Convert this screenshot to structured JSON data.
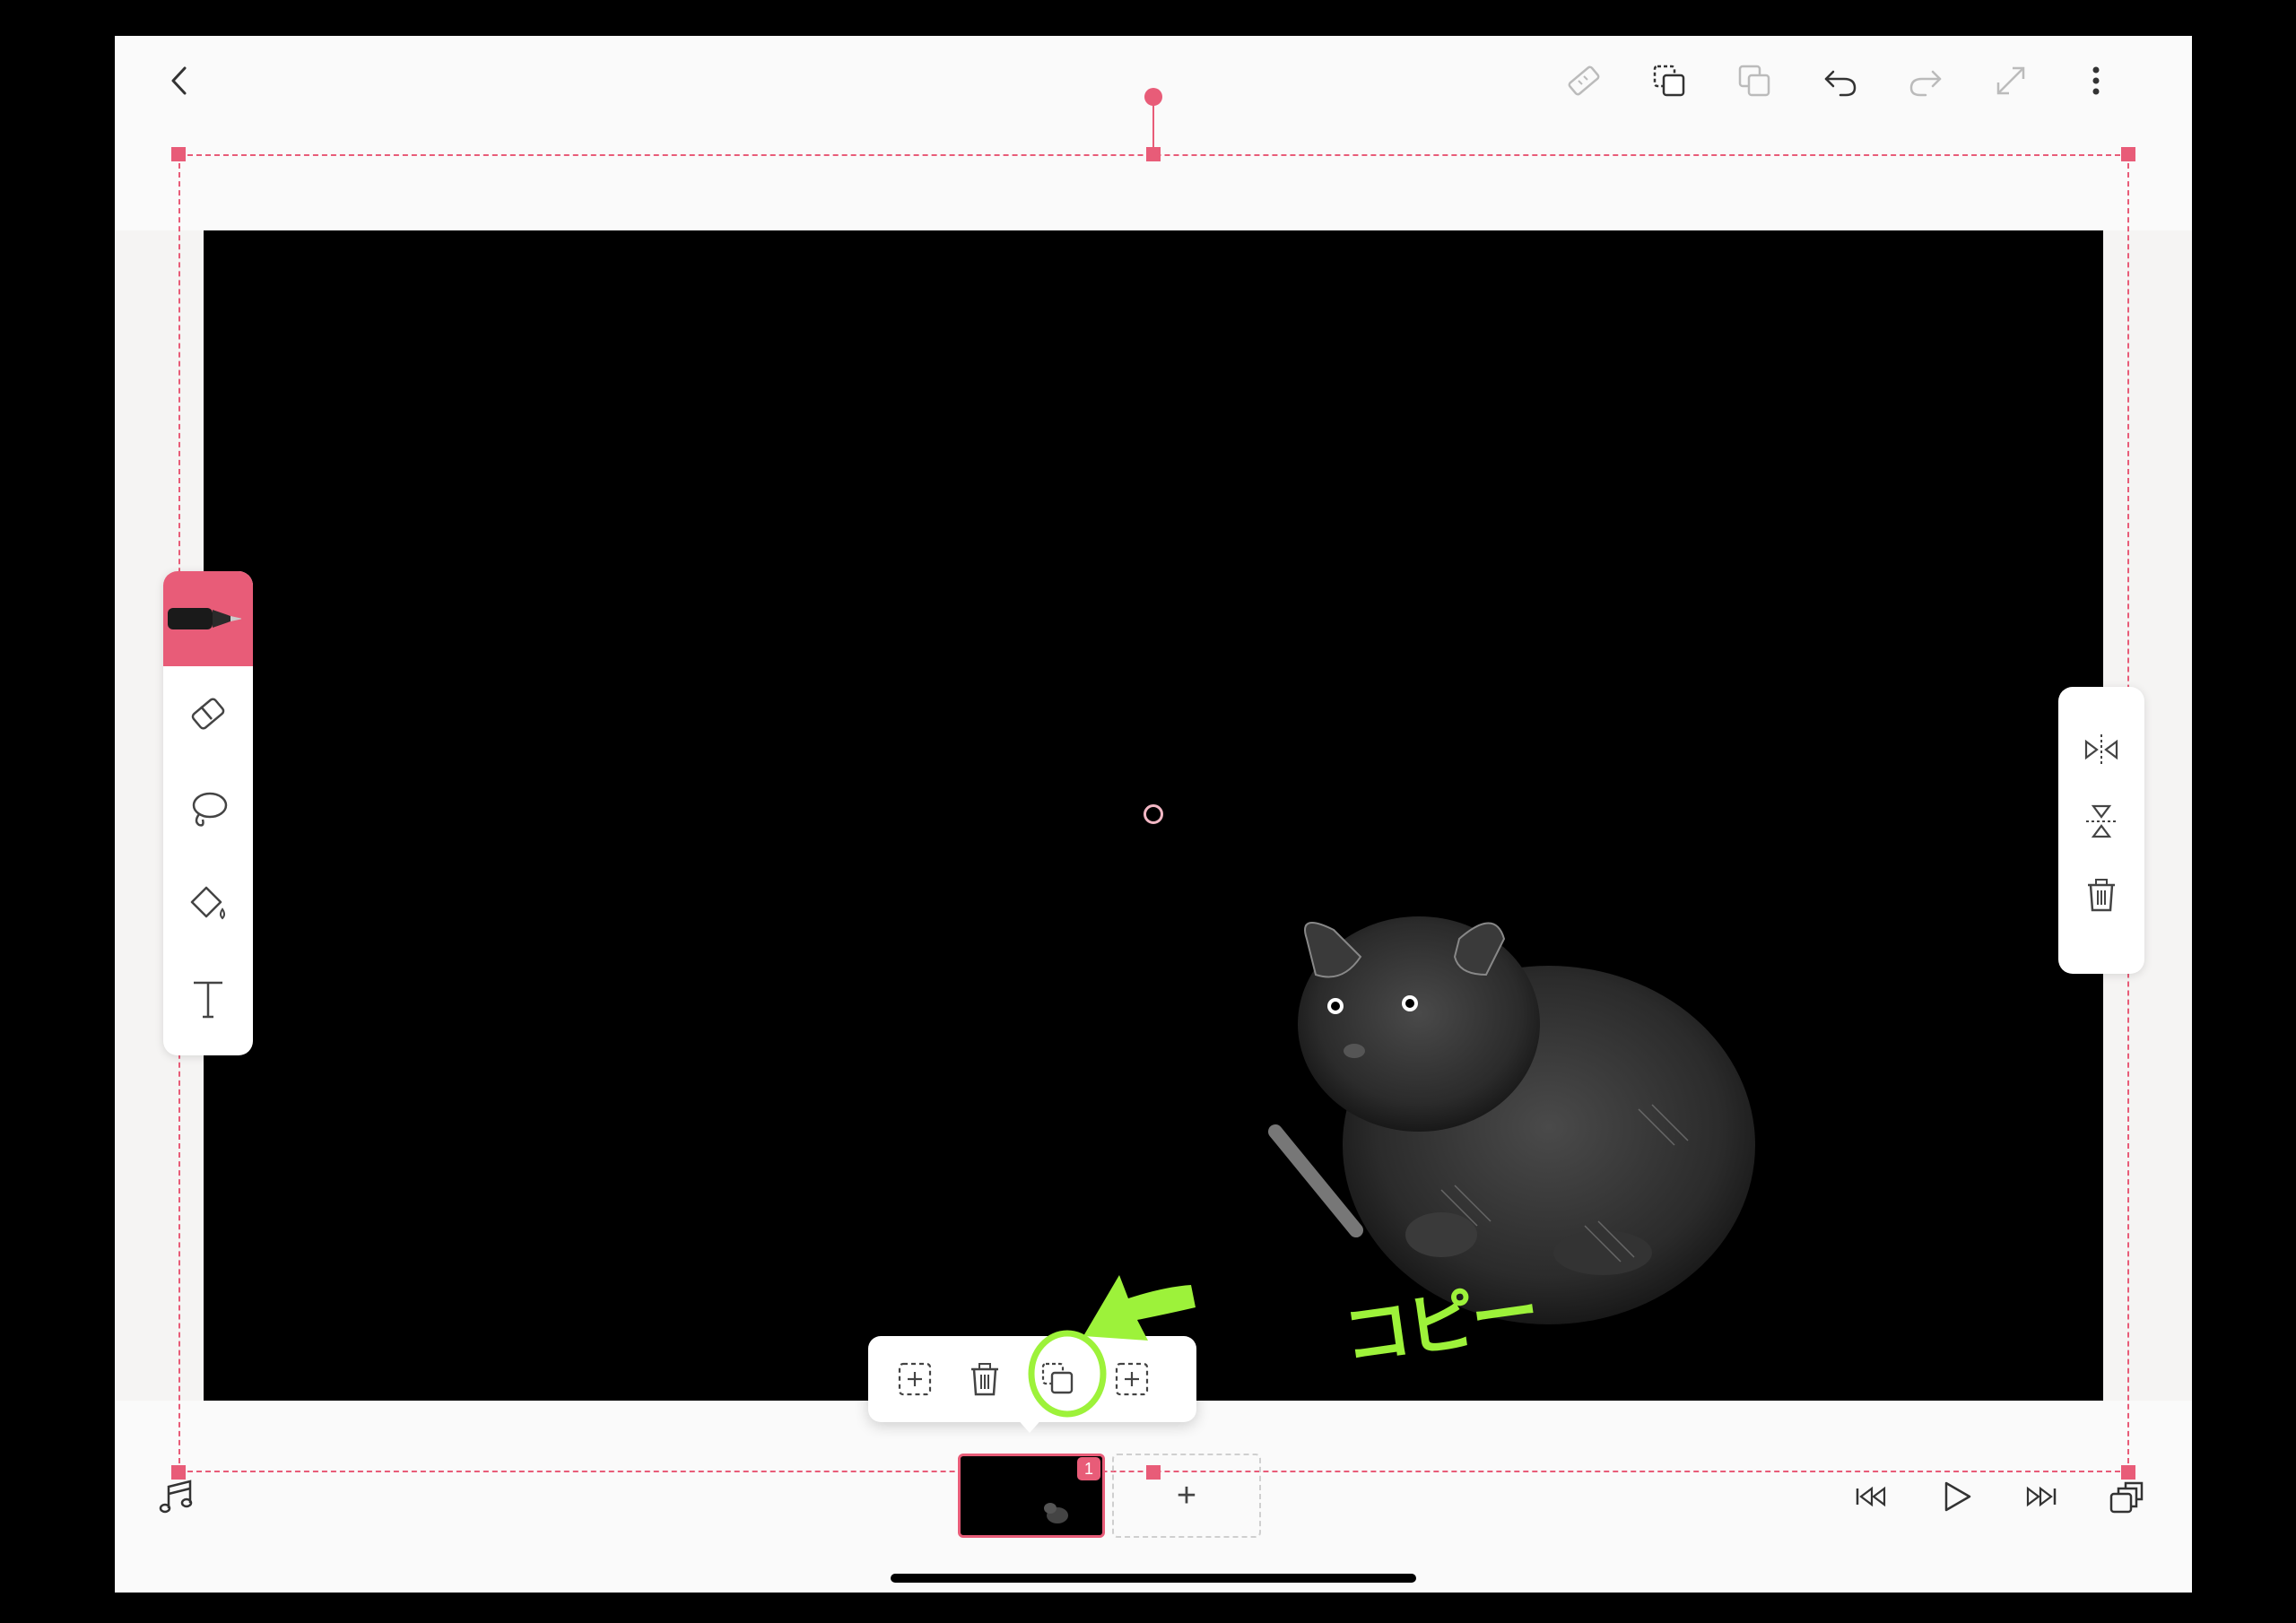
{
  "annotation": {
    "text": "コピー",
    "color": "#9df23a"
  },
  "topbar": {
    "icons": [
      "back-icon",
      "ruler-icon",
      "copy-icon",
      "paste-icon",
      "undo-icon",
      "redo-icon",
      "expand-icon",
      "more-icon"
    ]
  },
  "tools": [
    "pen-tool",
    "eraser-tool",
    "lasso-tool",
    "fill-tool",
    "text-tool"
  ],
  "transform_tools": [
    "flip-horizontal",
    "flip-vertical",
    "delete"
  ],
  "context_menu": [
    "paste-selection",
    "delete",
    "copy",
    "select-all"
  ],
  "timeline": {
    "frame_number": "1",
    "add_label": "+"
  },
  "colors": {
    "accent": "#e85c78",
    "canvas": "#000000",
    "annotation": "#9df23a"
  }
}
